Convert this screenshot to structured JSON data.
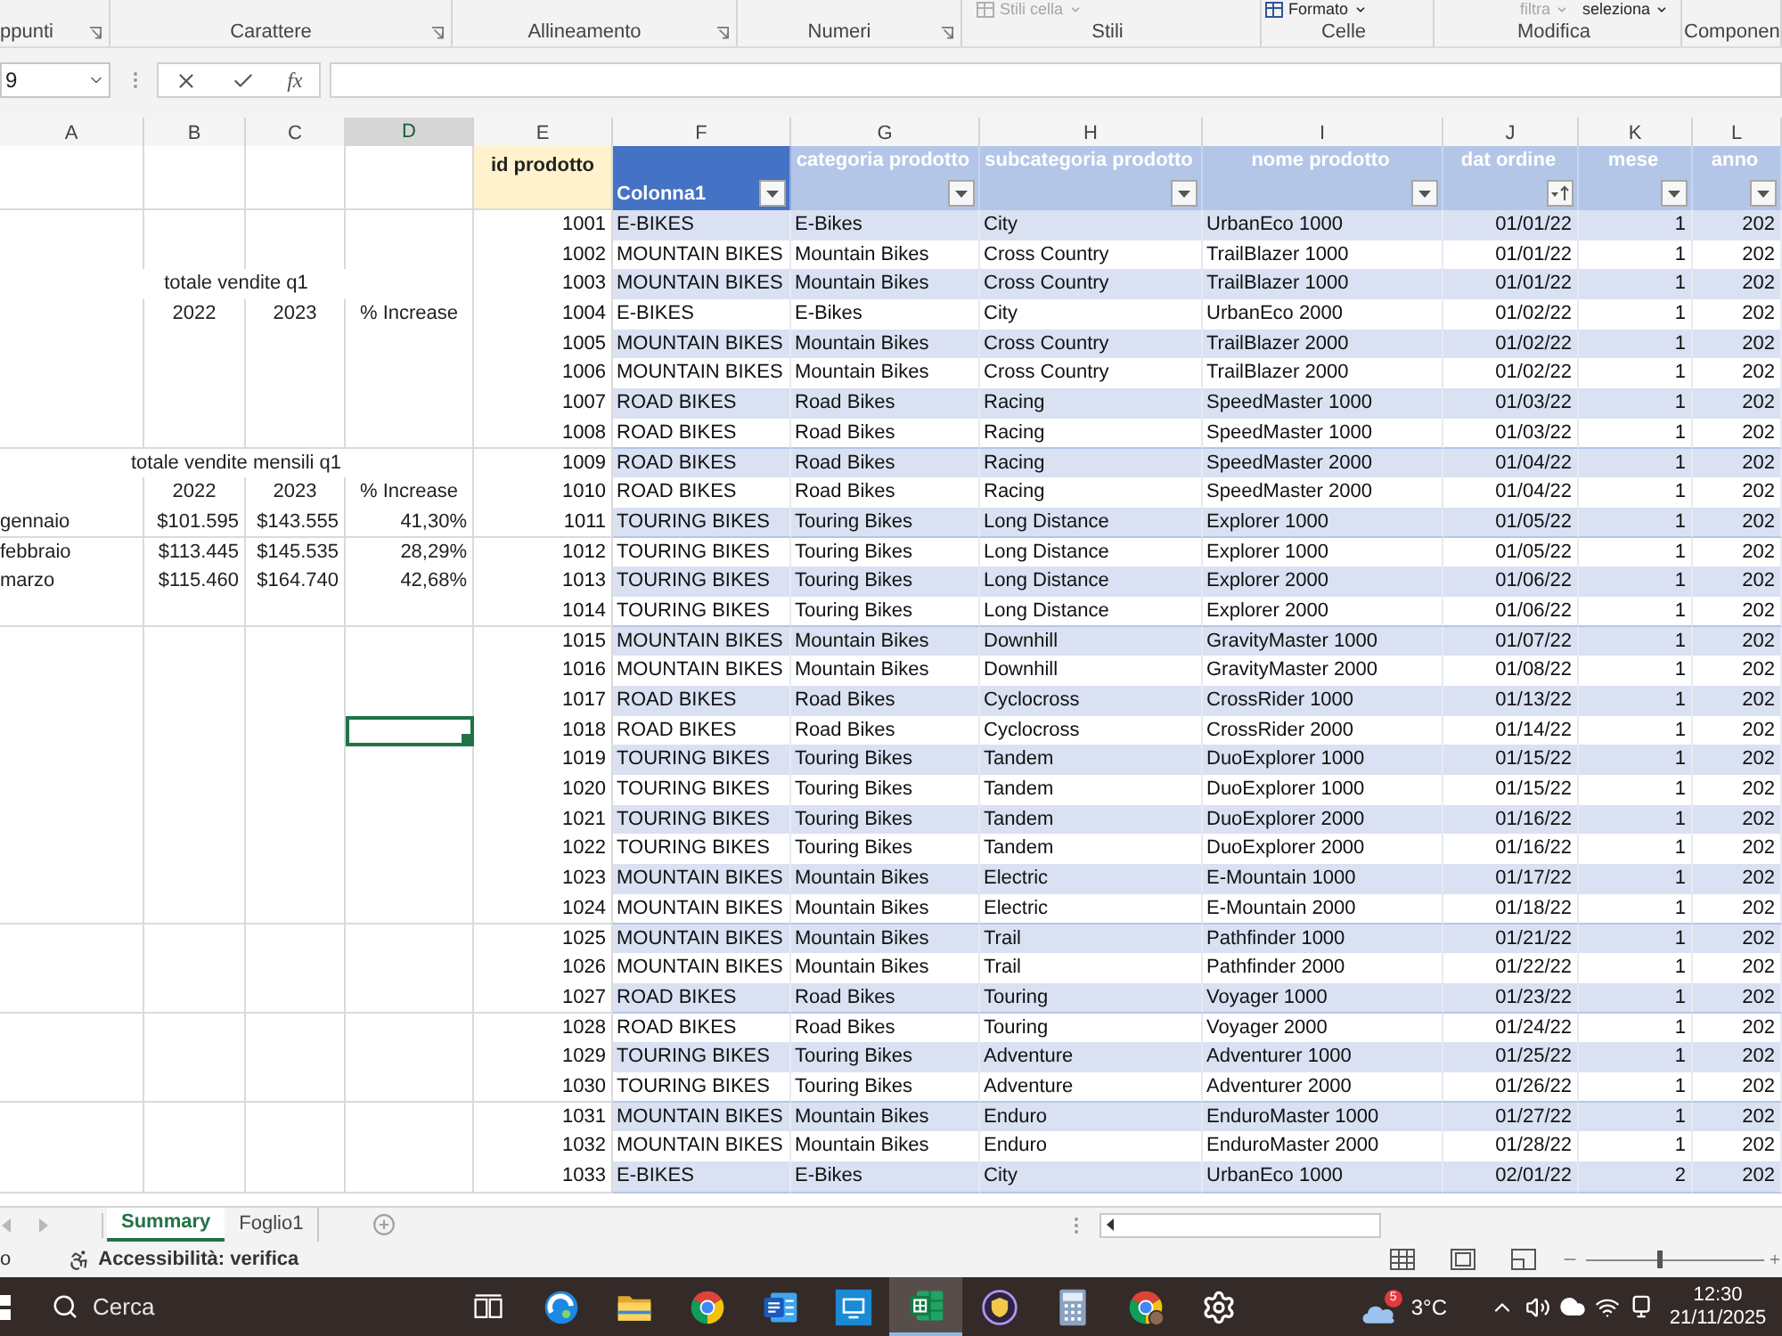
{
  "ribbon": {
    "groups": [
      {
        "label": "ppunti",
        "launcher": true
      },
      {
        "label": "Carattere",
        "launcher": true
      },
      {
        "label": "Allineamento",
        "launcher": true
      },
      {
        "label": "Numeri",
        "launcher": true
      },
      {
        "label": "Stili",
        "launcher": false,
        "items": [
          {
            "label": "Stili cella",
            "disabled": true,
            "icon": true
          }
        ]
      },
      {
        "label": "Celle",
        "launcher": false,
        "items": [
          {
            "label": "Formato",
            "disabled": false,
            "icon": true
          }
        ]
      },
      {
        "label": "Modifica",
        "launcher": false,
        "items": [
          {
            "label": "filtra",
            "disabled": true,
            "icon": false
          },
          {
            "label": "seleziona",
            "disabled": false,
            "icon": false
          }
        ]
      },
      {
        "label": "Componen",
        "launcher": false
      }
    ]
  },
  "formula_bar": {
    "name_box": "9",
    "function_button": "fx"
  },
  "columns": [
    {
      "label": "A",
      "selected": false
    },
    {
      "label": "B",
      "selected": false
    },
    {
      "label": "C",
      "selected": false
    },
    {
      "label": "D",
      "selected": true
    },
    {
      "label": "E",
      "selected": false
    },
    {
      "label": "F",
      "selected": false
    },
    {
      "label": "G",
      "selected": false
    },
    {
      "label": "H",
      "selected": false
    },
    {
      "label": "I",
      "selected": false
    },
    {
      "label": "J",
      "selected": false
    },
    {
      "label": "K",
      "selected": false
    },
    {
      "label": "L",
      "selected": false
    }
  ],
  "summary": [
    {
      "title": "totale vendite q1",
      "headers": [
        "2022",
        "2023",
        "% Increase"
      ]
    },
    {
      "title": "totale vendite mensili q1",
      "headers": [
        "2022",
        "2023",
        "% Increase"
      ],
      "rows": [
        {
          "label": "gennaio",
          "values": [
            "$101.595",
            "$143.555",
            "41,30%"
          ]
        },
        {
          "label": "febbraio",
          "values": [
            "$113.445",
            "$145.535",
            "28,29%"
          ]
        },
        {
          "label": "marzo",
          "values": [
            "$115.460",
            "$164.740",
            "42,68%"
          ]
        }
      ]
    }
  ],
  "table": {
    "id_header": "id prodotto",
    "headers": [
      {
        "label": "Colonna1",
        "kind": "dark",
        "sorted": false
      },
      {
        "label": "categoria prodotto",
        "kind": "light",
        "sorted": false
      },
      {
        "label": "subcategoria prodotto",
        "kind": "light",
        "sorted": false
      },
      {
        "label": "nome prodotto",
        "kind": "light",
        "sorted": false
      },
      {
        "label": "dat ordine",
        "kind": "light",
        "sorted": true
      },
      {
        "label": "mese",
        "kind": "light",
        "sorted": false
      },
      {
        "label": "anno",
        "kind": "light",
        "sorted": false
      }
    ],
    "rows": [
      {
        "id": "1001",
        "values": [
          "E-BIKES",
          "E-Bikes",
          "City",
          "UrbanEco 1000",
          "01/01/22",
          "1",
          "202"
        ],
        "active": false
      },
      {
        "id": "1002",
        "values": [
          "MOUNTAIN BIKES",
          "Mountain Bikes",
          "Cross Country",
          "TrailBlazer 1000",
          "01/01/22",
          "1",
          "202"
        ],
        "active": false
      },
      {
        "id": "1003",
        "values": [
          "MOUNTAIN BIKES",
          "Mountain Bikes",
          "Cross Country",
          "TrailBlazer 1000",
          "01/01/22",
          "1",
          "202"
        ],
        "active": false
      },
      {
        "id": "1004",
        "values": [
          "E-BIKES",
          "E-Bikes",
          "City",
          "UrbanEco 2000",
          "01/02/22",
          "1",
          "202"
        ],
        "active": false
      },
      {
        "id": "1005",
        "values": [
          "MOUNTAIN BIKES",
          "Mountain Bikes",
          "Cross Country",
          "TrailBlazer 2000",
          "01/02/22",
          "1",
          "202"
        ],
        "active": false
      },
      {
        "id": "1006",
        "values": [
          "MOUNTAIN BIKES",
          "Mountain Bikes",
          "Cross Country",
          "TrailBlazer 2000",
          "01/02/22",
          "1",
          "202"
        ],
        "active": false
      },
      {
        "id": "1007",
        "values": [
          "ROAD BIKES",
          "Road Bikes",
          "Racing",
          "SpeedMaster 1000",
          "01/03/22",
          "1",
          "202"
        ],
        "active": false
      },
      {
        "id": "1008",
        "values": [
          "ROAD BIKES",
          "Road Bikes",
          "Racing",
          "SpeedMaster 1000",
          "01/03/22",
          "1",
          "202"
        ],
        "active": false
      },
      {
        "id": "1009",
        "values": [
          "ROAD BIKES",
          "Road Bikes",
          "Racing",
          "SpeedMaster 2000",
          "01/04/22",
          "1",
          "202"
        ],
        "active": false
      },
      {
        "id": "1010",
        "values": [
          "ROAD BIKES",
          "Road Bikes",
          "Racing",
          "SpeedMaster 2000",
          "01/04/22",
          "1",
          "202"
        ],
        "active": false
      },
      {
        "id": "1011",
        "values": [
          "TOURING BIKES",
          "Touring Bikes",
          "Long Distance",
          "Explorer 1000",
          "01/05/22",
          "1",
          "202"
        ],
        "active": false
      },
      {
        "id": "1012",
        "values": [
          "TOURING BIKES",
          "Touring Bikes",
          "Long Distance",
          "Explorer 1000",
          "01/05/22",
          "1",
          "202"
        ],
        "active": false
      },
      {
        "id": "1013",
        "values": [
          "TOURING BIKES",
          "Touring Bikes",
          "Long Distance",
          "Explorer 2000",
          "01/06/22",
          "1",
          "202"
        ],
        "active": false
      },
      {
        "id": "1014",
        "values": [
          "TOURING BIKES",
          "Touring Bikes",
          "Long Distance",
          "Explorer 2000",
          "01/06/22",
          "1",
          "202"
        ],
        "active": false
      },
      {
        "id": "1015",
        "values": [
          "MOUNTAIN BIKES",
          "Mountain Bikes",
          "Downhill",
          "GravityMaster 1000",
          "01/07/22",
          "1",
          "202"
        ],
        "active": false
      },
      {
        "id": "1016",
        "values": [
          "MOUNTAIN BIKES",
          "Mountain Bikes",
          "Downhill",
          "GravityMaster 2000",
          "01/08/22",
          "1",
          "202"
        ],
        "active": false
      },
      {
        "id": "1017",
        "values": [
          "ROAD BIKES",
          "Road Bikes",
          "Cyclocross",
          "CrossRider 1000",
          "01/13/22",
          "1",
          "202"
        ],
        "active": false
      },
      {
        "id": "1018",
        "values": [
          "ROAD BIKES",
          "Road Bikes",
          "Cyclocross",
          "CrossRider 2000",
          "01/14/22",
          "1",
          "202"
        ],
        "active": true
      },
      {
        "id": "1019",
        "values": [
          "TOURING BIKES",
          "Touring Bikes",
          "Tandem",
          "DuoExplorer 1000",
          "01/15/22",
          "1",
          "202"
        ],
        "active": false
      },
      {
        "id": "1020",
        "values": [
          "TOURING BIKES",
          "Touring Bikes",
          "Tandem",
          "DuoExplorer 1000",
          "01/15/22",
          "1",
          "202"
        ],
        "active": false
      },
      {
        "id": "1021",
        "values": [
          "TOURING BIKES",
          "Touring Bikes",
          "Tandem",
          "DuoExplorer 2000",
          "01/16/22",
          "1",
          "202"
        ],
        "active": false
      },
      {
        "id": "1022",
        "values": [
          "TOURING BIKES",
          "Touring Bikes",
          "Tandem",
          "DuoExplorer 2000",
          "01/16/22",
          "1",
          "202"
        ],
        "active": false
      },
      {
        "id": "1023",
        "values": [
          "MOUNTAIN BIKES",
          "Mountain Bikes",
          "Electric",
          "E-Mountain 1000",
          "01/17/22",
          "1",
          "202"
        ],
        "active": false
      },
      {
        "id": "1024",
        "values": [
          "MOUNTAIN BIKES",
          "Mountain Bikes",
          "Electric",
          "E-Mountain 2000",
          "01/18/22",
          "1",
          "202"
        ],
        "active": false
      },
      {
        "id": "1025",
        "values": [
          "MOUNTAIN BIKES",
          "Mountain Bikes",
          "Trail",
          "Pathfinder 1000",
          "01/21/22",
          "1",
          "202"
        ],
        "active": false
      },
      {
        "id": "1026",
        "values": [
          "MOUNTAIN BIKES",
          "Mountain Bikes",
          "Trail",
          "Pathfinder 2000",
          "01/22/22",
          "1",
          "202"
        ],
        "active": false
      },
      {
        "id": "1027",
        "values": [
          "ROAD BIKES",
          "Road Bikes",
          "Touring",
          "Voyager 1000",
          "01/23/22",
          "1",
          "202"
        ],
        "active": false
      },
      {
        "id": "1028",
        "values": [
          "ROAD BIKES",
          "Road Bikes",
          "Touring",
          "Voyager 2000",
          "01/24/22",
          "1",
          "202"
        ],
        "active": false
      },
      {
        "id": "1029",
        "values": [
          "TOURING BIKES",
          "Touring Bikes",
          "Adventure",
          "Adventurer 1000",
          "01/25/22",
          "1",
          "202"
        ],
        "active": false
      },
      {
        "id": "1030",
        "values": [
          "TOURING BIKES",
          "Touring Bikes",
          "Adventure",
          "Adventurer 2000",
          "01/26/22",
          "1",
          "202"
        ],
        "active": false
      },
      {
        "id": "1031",
        "values": [
          "MOUNTAIN BIKES",
          "Mountain Bikes",
          "Enduro",
          "EnduroMaster 1000",
          "01/27/22",
          "1",
          "202"
        ],
        "active": false
      },
      {
        "id": "1032",
        "values": [
          "MOUNTAIN BIKES",
          "Mountain Bikes",
          "Enduro",
          "EnduroMaster 2000",
          "01/28/22",
          "1",
          "202"
        ],
        "active": false
      },
      {
        "id": "1033",
        "values": [
          "E-BIKES",
          "E-Bikes",
          "City",
          "UrbanEco 1000",
          "02/01/22",
          "2",
          "202"
        ],
        "active": false
      }
    ]
  },
  "sheet_tabs": [
    {
      "label": "Summary",
      "selected": true
    },
    {
      "label": "Foglio1",
      "selected": false
    }
  ],
  "status_bar": {
    "mode": "o",
    "accessibility": "Accessibilità: verifica",
    "zoom": {
      "level": 0.41
    }
  },
  "taskbar": {
    "search_placeholder": "Cerca",
    "apps": [
      {
        "kind": "task-view",
        "active": false
      },
      {
        "kind": "edge",
        "active": false
      },
      {
        "kind": "files",
        "active": false
      },
      {
        "kind": "chrome",
        "active": false
      },
      {
        "kind": "word",
        "active": false
      },
      {
        "kind": "remote",
        "active": false
      },
      {
        "kind": "excel",
        "active": true
      },
      {
        "kind": "vpn",
        "active": false
      },
      {
        "kind": "calculator",
        "active": false
      },
      {
        "kind": "chrome-profile",
        "active": false
      },
      {
        "kind": "settings",
        "active": false
      }
    ],
    "weather": {
      "badge": "5",
      "temperature": "3°C"
    },
    "time": "12:30",
    "date": "21/11/2025"
  }
}
